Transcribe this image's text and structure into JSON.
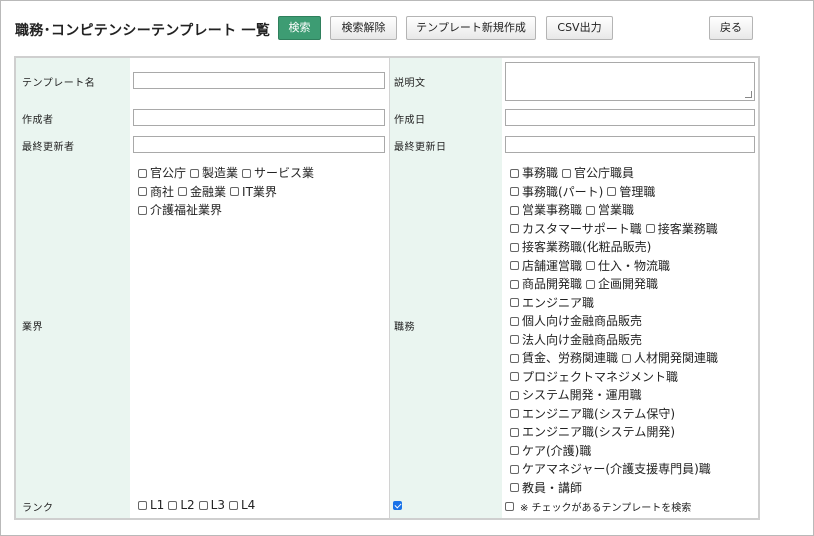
{
  "header": {
    "title": "職務･コンピテンシーテンプレート 一覧",
    "buttons": {
      "search": "検索",
      "clear": "検索解除",
      "new_template": "テンプレート新規作成",
      "csv": "CSV出力",
      "back": "戻る"
    }
  },
  "form": {
    "labels": {
      "template_name": "テンプレート名",
      "description": "説明文",
      "creator": "作成者",
      "created_date": "作成日",
      "last_updater": "最終更新者",
      "last_updated_date": "最終更新日",
      "industry": "業界",
      "job": "職務",
      "rank": "ランク"
    },
    "values": {
      "template_name": "",
      "description": "",
      "creator": "",
      "created_date": "",
      "last_updater": "",
      "last_updated_date": ""
    },
    "industry_options": [
      [
        "官公庁",
        "製造業",
        "サービス業"
      ],
      [
        "商社",
        "金融業",
        "IT業界"
      ],
      [
        "介護福祉業界"
      ]
    ],
    "job_options": [
      [
        "事務職",
        "官公庁職員"
      ],
      [
        "事務職(パート)",
        "管理職"
      ],
      [
        "営業事務職",
        "営業職"
      ],
      [
        "カスタマーサポート職",
        "接客業務職"
      ],
      [
        "接客業務職(化粧品販売)"
      ],
      [
        "店舗運営職",
        "仕入・物流職"
      ],
      [
        "商品開発職",
        "企画開発職"
      ],
      [
        "エンジニア職"
      ],
      [
        "個人向け金融商品販売"
      ],
      [
        "法人向け金融商品販売"
      ],
      [
        "賃金、労務関連職",
        "人材開発関連職"
      ],
      [
        "プロジェクトマネジメント職"
      ],
      [
        "システム開発・運用職"
      ],
      [
        "エンジニア職(システム保守)"
      ],
      [
        "エンジニア職(システム開発)"
      ],
      [
        "ケア(介護)職"
      ],
      [
        "ケアマネジャー(介護支援専門員)職"
      ],
      [
        "教員・講師"
      ]
    ],
    "rank_options": [
      "L1",
      "L2",
      "L3",
      "L4"
    ],
    "rank_flag_checked": true,
    "checked_template_search_label": "※ チェックがあるテンプレートを検索"
  },
  "colors": {
    "primary_button": "#3d9c73",
    "label_column_bg": "#eaf5f0",
    "checkbox_checked": "#1a73e8"
  }
}
